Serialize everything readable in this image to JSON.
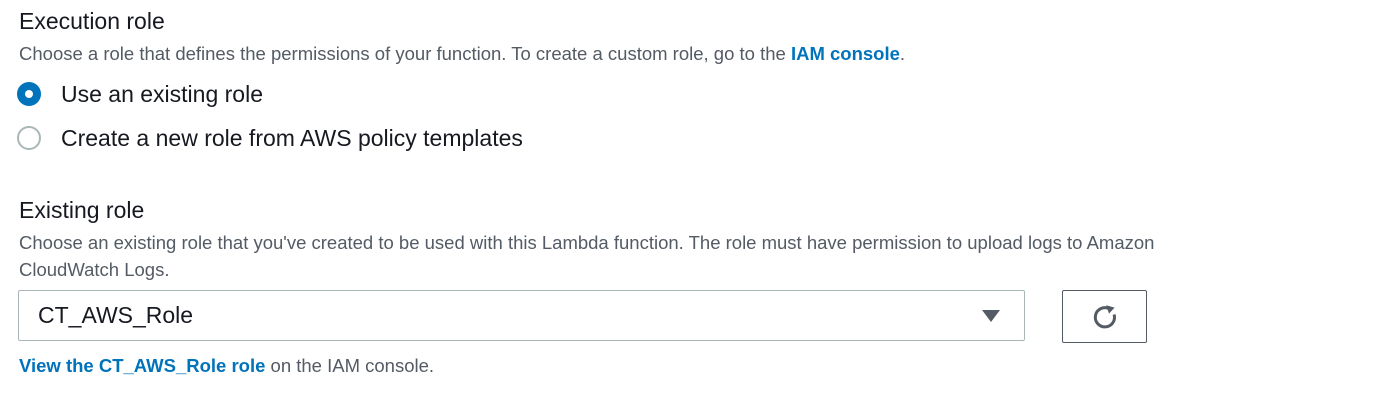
{
  "execution_role": {
    "title": "Execution role",
    "description_prefix": "Choose a role that defines the permissions of your function. To create a custom role, go to the ",
    "description_link": "IAM console",
    "description_suffix": ".",
    "options": [
      {
        "label": "Use an existing role",
        "selected": true
      },
      {
        "label": "Create a new role from AWS policy templates",
        "selected": false
      }
    ]
  },
  "existing_role": {
    "title": "Existing role",
    "description_line1": "Choose an existing role that you've created to be used with this Lambda function. The role must have permission to upload logs to Amazon",
    "description_line2": "CloudWatch Logs.",
    "selected_value": "CT_AWS_Role",
    "refresh_icon": "refresh-icon",
    "view_link": "View the CT_AWS_Role role",
    "view_suffix": " on the IAM console."
  },
  "colors": {
    "accent": "#0073bb",
    "text": "#16191f",
    "secondary_text": "#545b64",
    "border": "#aab7b8"
  }
}
